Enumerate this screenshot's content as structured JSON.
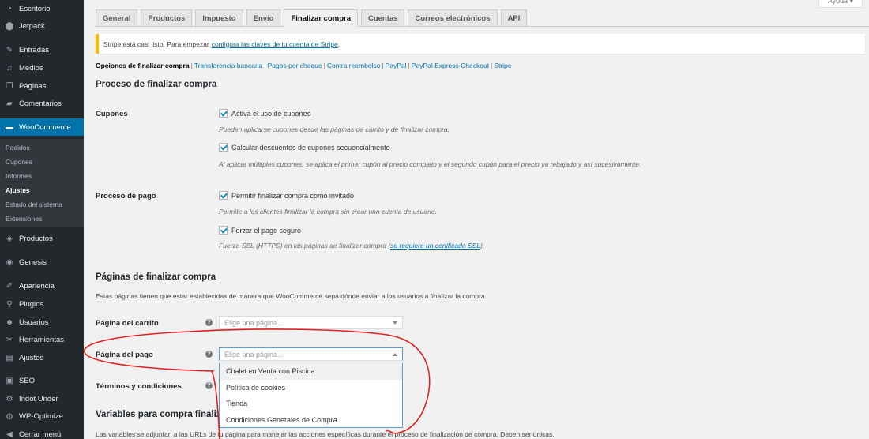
{
  "admin_menu": [
    {
      "label": "Escritorio",
      "icon": "dashboard-icon"
    },
    {
      "label": "Jetpack",
      "icon": "jetpack-icon"
    },
    {
      "label": "Entradas",
      "icon": "pin-icon"
    },
    {
      "label": "Medios",
      "icon": "media-icon"
    },
    {
      "label": "Páginas",
      "icon": "pages-icon"
    },
    {
      "label": "Comentarios",
      "icon": "comments-icon"
    },
    {
      "label": "WooCommerce",
      "icon": "woocommerce-icon"
    },
    {
      "label": "Productos",
      "icon": "products-icon"
    },
    {
      "label": "Genesis",
      "icon": "genesis-icon"
    },
    {
      "label": "Apariencia",
      "icon": "appearance-icon"
    },
    {
      "label": "Plugins",
      "icon": "plugins-icon"
    },
    {
      "label": "Usuarios",
      "icon": "users-icon"
    },
    {
      "label": "Herramientas",
      "icon": "tools-icon"
    },
    {
      "label": "Ajustes",
      "icon": "settings-icon"
    },
    {
      "label": "SEO",
      "icon": "seo-icon"
    },
    {
      "label": "Indot Under",
      "icon": "gear-icon"
    },
    {
      "label": "WP-Optimize",
      "icon": "optimize-icon"
    },
    {
      "label": "Cerrar menú",
      "icon": "collapse-icon"
    }
  ],
  "woo_submenu": [
    "Pedidos",
    "Cupones",
    "Informes",
    "Ajustes",
    "Estado del sistema",
    "Extensiones"
  ],
  "help_tab": "Ayuda ▾",
  "tabs": [
    "General",
    "Productos",
    "Impuesto",
    "Envío",
    "Finalizar compra",
    "Cuentas",
    "Correos electrónicos",
    "API"
  ],
  "notice": {
    "text": "Stripe está casi listo. Para empezar",
    "link": "configura las claves de tu cuenta de Stripe",
    "end": "."
  },
  "sections": [
    "Opciones de finalizar compra",
    "Transferencia bancaria",
    "Pagos por cheque",
    "Contra reembolso",
    "PayPal",
    "PayPal Express Checkout",
    "Stripe"
  ],
  "process": {
    "title": "Proceso de finalizar compra",
    "coupons_label": "Cupones",
    "enable_coupons": "Activa el uso de cupones",
    "enable_coupons_desc": "Pueden aplicarse cupones desde las páginas de carrito y de finalizar compra.",
    "sequential": "Calcular descuentos de cupones secuencialmente",
    "sequential_desc": "Al aplicar múltiples cupones, se aplica el primer cupón al precio completo y el segundo cupón para el precio ya rebajado y así sucesivamente.",
    "payment_label": "Proceso de pago",
    "guest": "Permitir finalizar compra como invitado",
    "guest_desc": "Permite a los clientes finalizar la compra sin crear una cuenta de usuario.",
    "secure": "Forzar el pago seguro",
    "secure_desc": "Fuerza SSL (HTTPS) en las páginas de finalizar compra (",
    "secure_link": "se requiere un certificado SSL",
    "secure_end": ")."
  },
  "pages": {
    "title": "Páginas de finalizar compra",
    "intro": "Estas páginas tienen que estar establecidas de manera que WooCommerce sepa dónde enviar a los usuarios a finalizar la compra.",
    "cart_label": "Página del carrito",
    "checkout_label": "Página del pago",
    "terms_label": "Términos y condiciones",
    "placeholder": "Elige una página...",
    "options": [
      "Chalet en Venta con Piscina",
      "Política de cookies",
      "Tienda",
      "Condiciones Generales de Compra"
    ]
  },
  "variables": {
    "title": "Variables para compra finalizada",
    "intro": "Las variables se adjuntan a las URLs de tu página para manejar las acciones específicas durante el proceso de finalización de compra. Deben ser únicas."
  },
  "colors": {
    "accent": "#0073aa",
    "notice_border": "#ffb900",
    "annotation": "#e02020"
  }
}
